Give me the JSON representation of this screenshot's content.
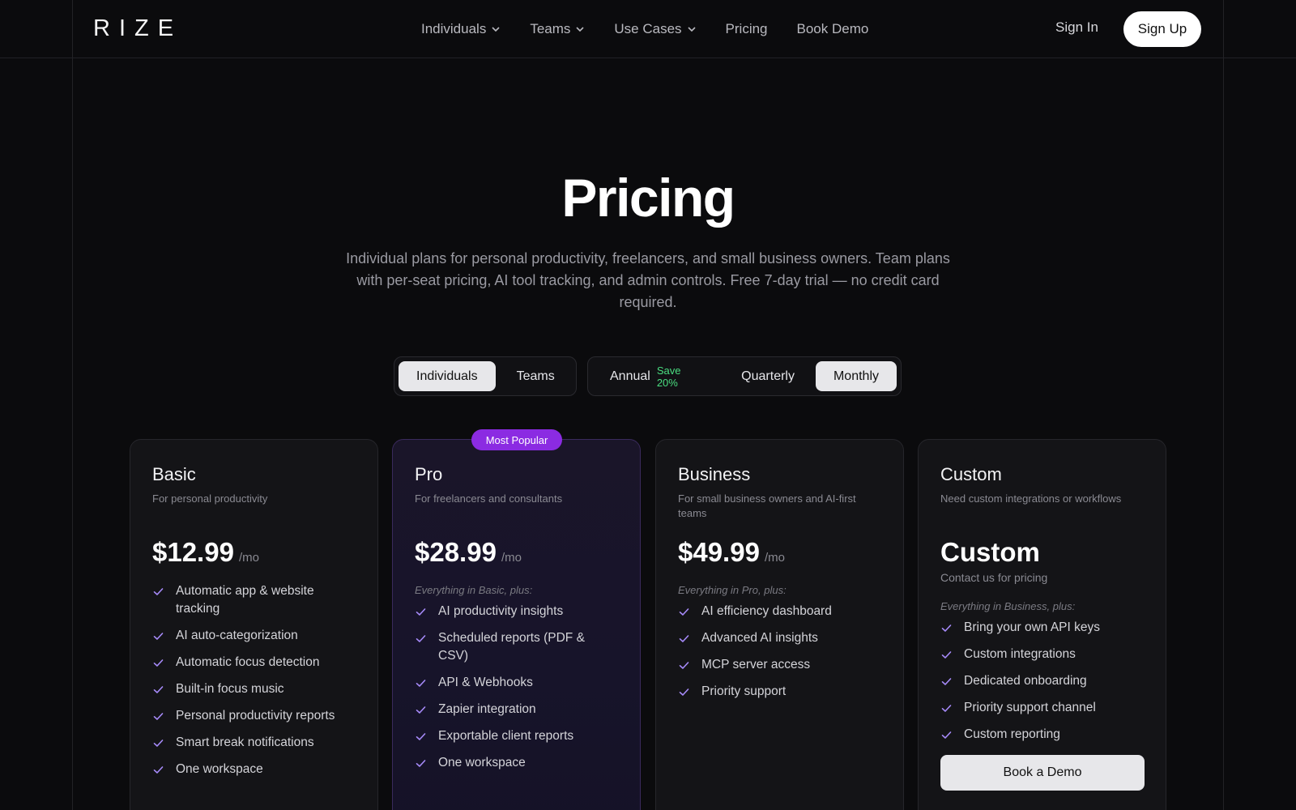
{
  "brand": {
    "logo": "RIZE"
  },
  "nav": {
    "items": [
      {
        "label": "Individuals",
        "has_dropdown": true
      },
      {
        "label": "Teams",
        "has_dropdown": true
      },
      {
        "label": "Use Cases",
        "has_dropdown": true
      },
      {
        "label": "Pricing",
        "has_dropdown": false
      },
      {
        "label": "Book Demo",
        "has_dropdown": false
      }
    ],
    "sign_in": "Sign In",
    "sign_up": "Sign Up"
  },
  "hero": {
    "title": "Pricing",
    "subtitle": "Individual plans for personal productivity, freelancers, and small business owners. Team plans with per-seat pricing, AI tool tracking, and admin controls. Free 7-day trial — no credit card required."
  },
  "audience_toggle": {
    "options": [
      "Individuals",
      "Teams"
    ],
    "selected": "Individuals"
  },
  "billing_toggle": {
    "annual": "Annual",
    "annual_badge": "Save 20%",
    "quarterly": "Quarterly",
    "monthly": "Monthly",
    "selected": "Monthly"
  },
  "colors": {
    "accent": "#8b2be2",
    "check": "#a78bfa",
    "save": "#4ade80",
    "background": "#0b0b0d"
  },
  "plans": [
    {
      "name": "Basic",
      "description": "For personal productivity",
      "price": "$12.99",
      "period": "/mo",
      "features": [
        "Automatic app & website tracking",
        "AI auto-categorization",
        "Automatic focus detection",
        "Built-in focus music",
        "Personal productivity reports",
        "Smart break notifications",
        "One workspace"
      ]
    },
    {
      "name": "Pro",
      "badge": "Most Popular",
      "description": "For freelancers and consultants",
      "price": "$28.99",
      "period": "/mo",
      "inherit": "Everything in Basic, plus:",
      "features": [
        "AI productivity insights",
        "Scheduled reports (PDF & CSV)",
        "API & Webhooks",
        "Zapier integration",
        "Exportable client reports",
        "One workspace"
      ]
    },
    {
      "name": "Business",
      "description": "For small business owners and AI-first teams",
      "price": "$49.99",
      "period": "/mo",
      "inherit": "Everything in Pro, plus:",
      "features": [
        "AI efficiency dashboard",
        "Advanced AI insights",
        "MCP server access",
        "Priority support"
      ]
    },
    {
      "name": "Custom",
      "description": "Need custom integrations or workflows",
      "price": "Custom",
      "contact": "Contact us for pricing",
      "inherit": "Everything in Business, plus:",
      "features": [
        "Bring your own API keys",
        "Custom integrations",
        "Dedicated onboarding",
        "Priority support channel",
        "Custom reporting"
      ],
      "cta": "Book a Demo"
    }
  ]
}
